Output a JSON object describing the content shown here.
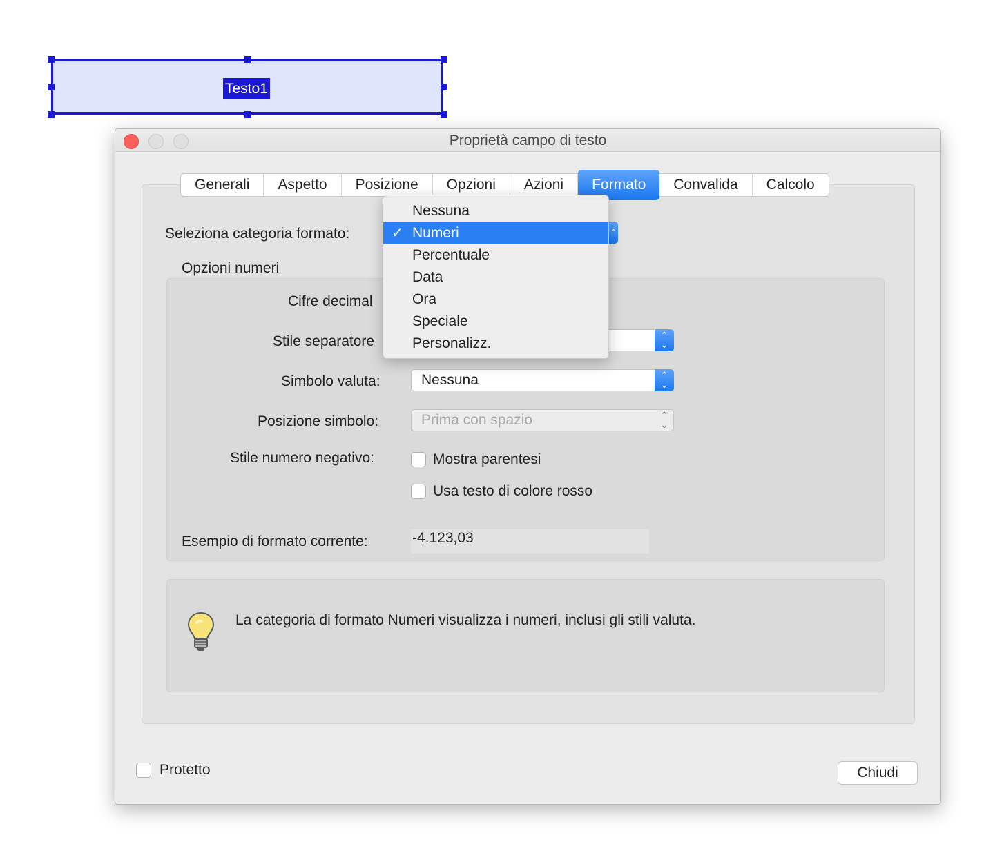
{
  "field": {
    "label": "Testo1"
  },
  "dialog": {
    "title": "Proprietà campo di testo",
    "tabs": [
      {
        "label": "Generali"
      },
      {
        "label": "Aspetto"
      },
      {
        "label": "Posizione"
      },
      {
        "label": "Opzioni"
      },
      {
        "label": "Azioni"
      },
      {
        "label": "Formato",
        "active": true
      },
      {
        "label": "Convalida"
      },
      {
        "label": "Calcolo"
      }
    ],
    "format_category_label": "Seleziona categoria formato:",
    "group_title": "Opzioni numeri",
    "decimals_label": "Cifre decimal",
    "separator_label": "Stile separatore",
    "currency_label": "Simbolo valuta:",
    "currency_value": "Nessuna",
    "symbol_position_label": "Posizione simbolo:",
    "symbol_position_value": "Prima con spazio",
    "negative_style_label": "Stile numero negativo:",
    "show_parentheses_label": "Mostra parentesi",
    "red_text_label": "Usa testo di colore rosso",
    "sample_label": "Esempio di formato corrente:",
    "sample_value": "-4.123,03",
    "info_text": "La categoria di formato Numeri visualizza i numeri, inclusi gli stili valuta.",
    "protected_label": "Protetto",
    "close_button": "Chiudi"
  },
  "category_menu": {
    "items": [
      "Nessuna",
      "Numeri",
      "Percentuale",
      "Data",
      "Ora",
      "Speciale",
      "Personalizz."
    ],
    "selected": "Numeri",
    "check_glyph": "✓"
  },
  "colors": {
    "selection_blue": "#1a1ad6",
    "accent": "#2a7ff3"
  }
}
